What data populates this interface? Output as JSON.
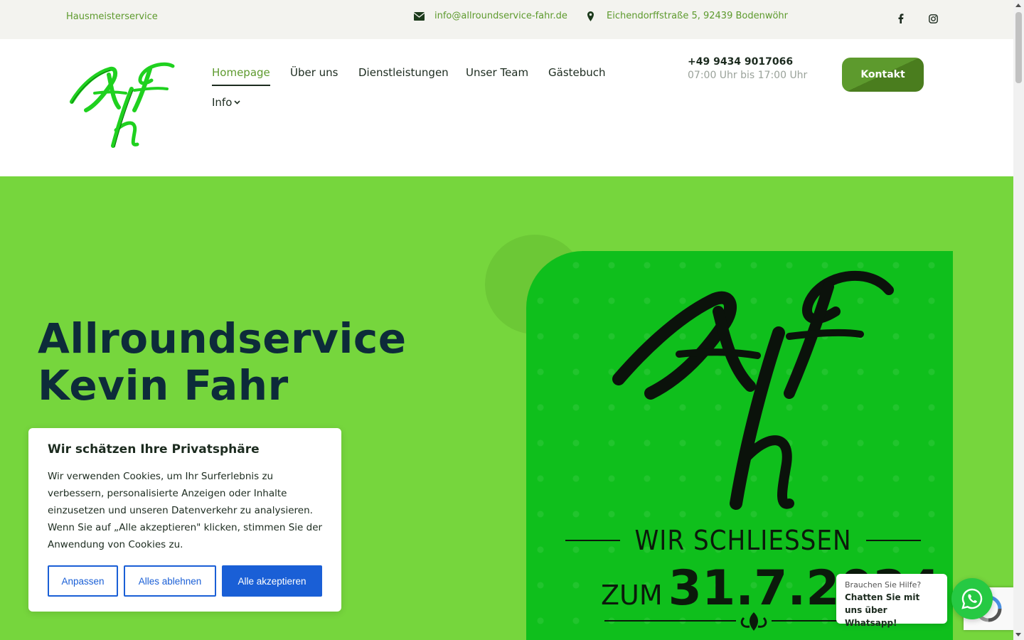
{
  "topbar": {
    "tagline": "Hausmeisterservice",
    "email": "info@allroundservice-fahr.de",
    "address": "Eichendorffstraße 5, 92439 Bodenwöhr",
    "icons": [
      "envelope-icon",
      "map-marker-icon",
      "facebook-icon",
      "instagram-icon"
    ]
  },
  "header": {
    "logo_alt": "AKF",
    "nav": [
      {
        "label": "Homepage",
        "active": true
      },
      {
        "label": "Über uns"
      },
      {
        "label": "Dienstleistungen"
      },
      {
        "label": "Unser Team"
      },
      {
        "label": "Gästebuch"
      },
      {
        "label": "Info"
      }
    ],
    "phone": "+49 9434 9017066",
    "hours": "07:00 Uhr bis 17:00 Uhr",
    "contact_button": "Kontakt"
  },
  "hero": {
    "title": "Allroundservice Kevin Fahr",
    "card_line1": "WIR SCHLIESSEN",
    "card_zum": "ZUM",
    "card_date": "31.7.2024"
  },
  "cookie": {
    "title": "Wir schätzen Ihre Privatsphäre",
    "text": "Wir verwenden Cookies, um Ihr Surferlebnis zu verbessern, personalisierte Anzeigen oder Inhalte einzusetzen und unseren Datenverkehr zu analysieren. Wenn Sie auf „Alle akzeptieren\" klicken, stimmen Sie der Anwendung von Cookies zu.",
    "btn_customize": "Anpassen",
    "btn_reject": "Alles ablehnen",
    "btn_accept": "Alle akzeptieren"
  },
  "whatsapp": {
    "small": "Brauchen Sie Hilfe?",
    "big": "Chatten Sie mit uns über Whatsapp!"
  },
  "colors": {
    "brand_green": "#5d9a2d",
    "hero_bg": "#76d63d",
    "card_bg": "#0fbf1c",
    "cookie_blue": "#1a5fd6",
    "whatsapp": "#26c943"
  }
}
